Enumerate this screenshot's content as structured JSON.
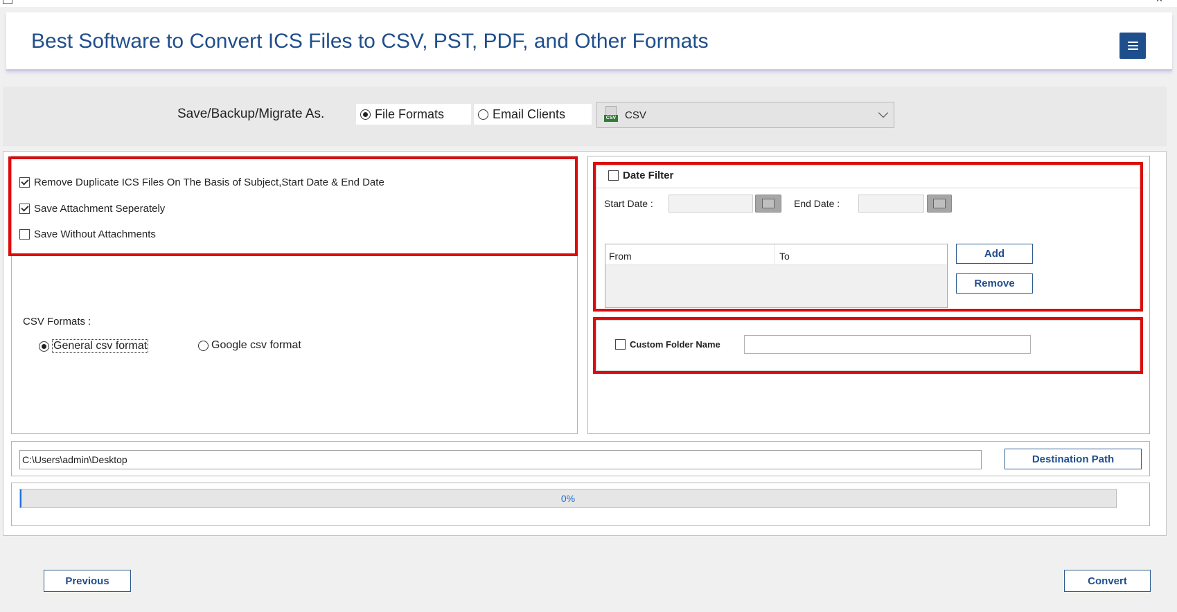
{
  "window": {
    "controls": [
      "–",
      "✕"
    ]
  },
  "header": {
    "title": "Best Software to Convert ICS Files to CSV, PST, PDF, and Other Formats"
  },
  "save_as": {
    "label": "Save/Backup/Migrate As.",
    "options": [
      {
        "label": "File Formats",
        "selected": true
      },
      {
        "label": "Email Clients",
        "selected": false
      }
    ],
    "format": {
      "selected": "CSV",
      "icon_text": "CSV"
    }
  },
  "options": [
    {
      "label": "Remove Duplicate ICS Files On The Basis of Subject,Start Date & End Date",
      "checked": true
    },
    {
      "label": "Save Attachment Seperately",
      "checked": true
    },
    {
      "label": "Save Without Attachments",
      "checked": false
    }
  ],
  "csv_formats": {
    "label": "CSV Formats :",
    "options": [
      {
        "label": "General csv format",
        "selected": true
      },
      {
        "label": "Google csv format",
        "selected": false
      }
    ]
  },
  "date_filter": {
    "label": "Date Filter",
    "checked": false,
    "start_label": "Start Date :",
    "end_label": "End Date :",
    "columns": [
      "From",
      "To"
    ],
    "add_label": "Add",
    "remove_label": "Remove"
  },
  "custom_folder": {
    "label": "Custom Folder Name",
    "checked": false,
    "value": ""
  },
  "destination": {
    "path": "C:\\Users\\admin\\Desktop",
    "button_label": "Destination Path"
  },
  "progress": {
    "percent": 0,
    "text": "0%"
  },
  "footer": {
    "previous_label": "Previous",
    "convert_label": "Convert"
  },
  "colors": {
    "accent": "#1f4e8c",
    "highlight_border": "#dd0b0b",
    "progress_text": "#1e6fd9"
  }
}
